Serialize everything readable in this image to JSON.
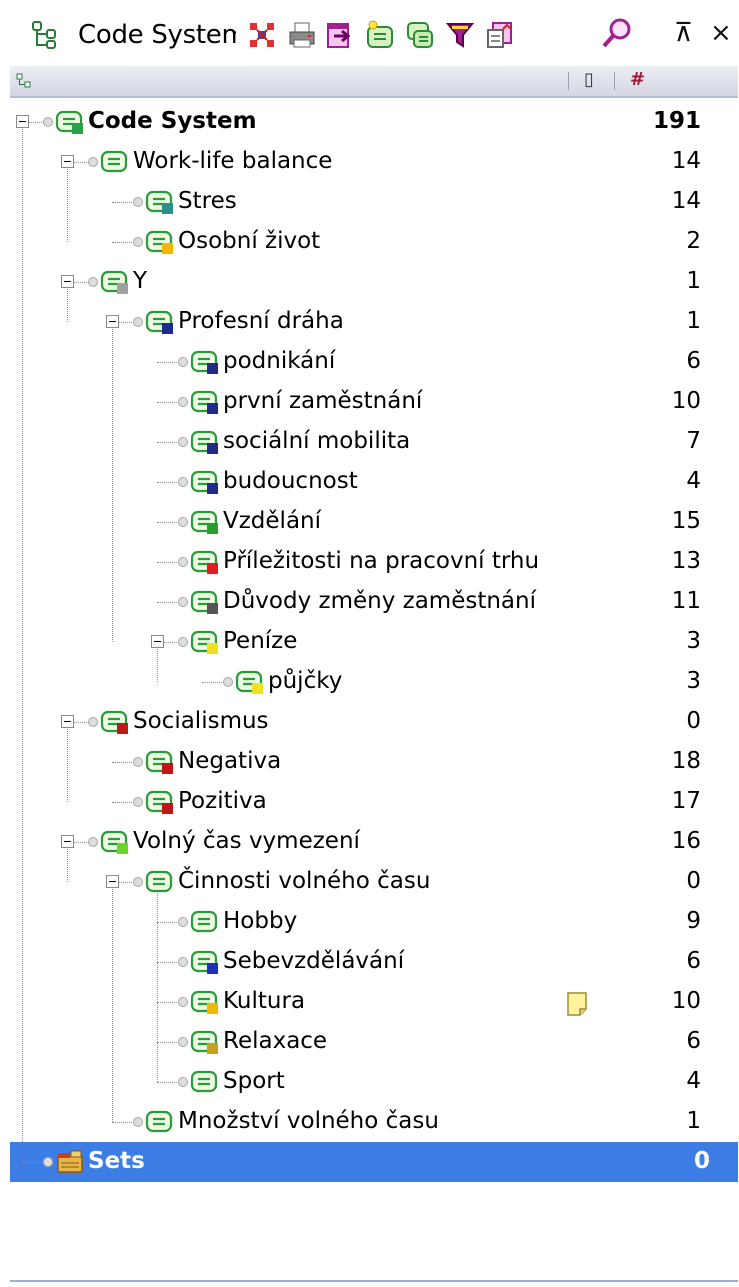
{
  "toolbar": {
    "title": "Code System",
    "icons": [
      "code-system-icon",
      "activate-all-icon",
      "print-icon",
      "export-icon",
      "new-code-icon",
      "code-set-icon",
      "filter-icon",
      "import-icon",
      "search-icon"
    ],
    "pin_label": "⊼",
    "close_label": "×"
  },
  "columns": {
    "memo_header": "▯",
    "count_header": "#"
  },
  "tree": [
    {
      "label": "Code System",
      "count": "191",
      "color": "#2ea04a",
      "bold": true
    },
    {
      "label": "Work-life balance",
      "count": "14",
      "color": ""
    },
    {
      "label": "Stres",
      "count": "14",
      "color": "#2b8f8a"
    },
    {
      "label": "Osobní život",
      "count": "2",
      "color": "#f0b800"
    },
    {
      "label": "Y",
      "count": "1",
      "color": "#a0a0a0"
    },
    {
      "label": "Profesní dráha",
      "count": "1",
      "color": "#1f2a8a"
    },
    {
      "label": "podnikání",
      "count": "6",
      "color": "#1f2a8a"
    },
    {
      "label": "první zaměstnání",
      "count": "10",
      "color": "#1f2a8a"
    },
    {
      "label": "sociální mobilita",
      "count": "7",
      "color": "#1f2a8a"
    },
    {
      "label": "budoucnost",
      "count": "4",
      "color": "#1f2a8a"
    },
    {
      "label": "Vzdělání",
      "count": "15",
      "color": "#2aa02a"
    },
    {
      "label": "Příležitosti na pracovní trhu",
      "count": "13",
      "color": "#e02020"
    },
    {
      "label": "Důvody změny zaměstnání",
      "count": "11",
      "color": "#555555"
    },
    {
      "label": "Peníze",
      "count": "3",
      "color": "#f0e020"
    },
    {
      "label": "půjčky",
      "count": "3",
      "color": "#f0e020"
    },
    {
      "label": "Socialismus",
      "count": "0",
      "color": "#c01818"
    },
    {
      "label": "Negativa",
      "count": "18",
      "color": "#c01818"
    },
    {
      "label": "Pozitiva",
      "count": "17",
      "color": "#c01818"
    },
    {
      "label": "Volný čas vymezení",
      "count": "16",
      "color": "#6bd32a"
    },
    {
      "label": "Činnosti volného času",
      "count": "0",
      "color": ""
    },
    {
      "label": "Hobby",
      "count": "9",
      "color": ""
    },
    {
      "label": "Sebevzdělávání",
      "count": "6",
      "color": "#2030b8"
    },
    {
      "label": "Kultura",
      "count": "10",
      "color": "#f0b800",
      "memo": true
    },
    {
      "label": "Relaxace",
      "count": "6",
      "color": "#c8a020"
    },
    {
      "label": "Sport",
      "count": "4",
      "color": ""
    },
    {
      "label": "Množství volného času",
      "count": "1",
      "color": ""
    },
    {
      "label": "Sets",
      "count": "0",
      "color": "",
      "selected": true
    }
  ]
}
